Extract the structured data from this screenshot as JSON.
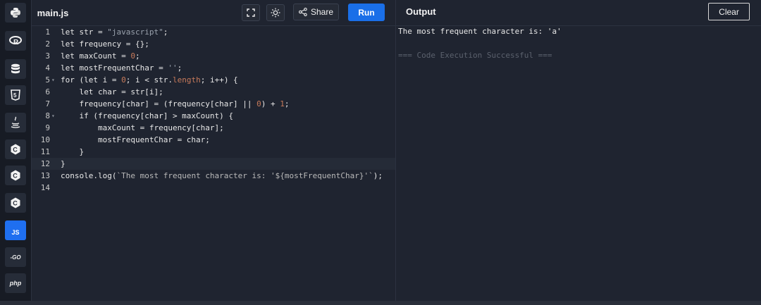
{
  "sidebar": {
    "items": [
      {
        "name": "python-icon",
        "label": ""
      },
      {
        "name": "r-icon",
        "label": "R"
      },
      {
        "name": "database-icon",
        "label": ""
      },
      {
        "name": "html5-icon",
        "label": "5"
      },
      {
        "name": "java-icon",
        "label": ""
      },
      {
        "name": "c-icon",
        "label": "C"
      },
      {
        "name": "cpp-icon",
        "label": "C"
      },
      {
        "name": "csharp-icon",
        "label": "C"
      },
      {
        "name": "javascript-icon",
        "label": "JS",
        "active": true
      },
      {
        "name": "go-icon",
        "label": "-GO"
      },
      {
        "name": "php-icon",
        "label": "php"
      }
    ]
  },
  "editor": {
    "file_name": "main.js",
    "share_label": "Share",
    "run_label": "Run",
    "lines": [
      {
        "n": "1",
        "fold": "",
        "html": "let str = <span class=\"str\">\"javascript\"</span>;"
      },
      {
        "n": "2",
        "fold": "",
        "html": "let frequency = {};"
      },
      {
        "n": "3",
        "fold": "",
        "html": "let maxCount = <span class=\"num\">0</span>;"
      },
      {
        "n": "4",
        "fold": "",
        "html": "let mostFrequentChar = <span class=\"str\">''</span>;"
      },
      {
        "n": "5",
        "fold": "▾",
        "html": "for (let i = <span class=\"num\">0</span>; i &lt; str.<span class=\"prop\">length</span>; i++) {"
      },
      {
        "n": "6",
        "fold": "",
        "html": "    let char = str[i];"
      },
      {
        "n": "7",
        "fold": "",
        "html": "    frequency[char] = (frequency[char] || <span class=\"num\">0</span>) + <span class=\"num\">1</span>;"
      },
      {
        "n": "8",
        "fold": "▾",
        "html": "    if (frequency[char] &gt; maxCount) {"
      },
      {
        "n": "9",
        "fold": "",
        "html": "        maxCount = frequency[char];"
      },
      {
        "n": "10",
        "fold": "",
        "html": "        mostFrequentChar = char;"
      },
      {
        "n": "11",
        "fold": "",
        "html": "    }"
      },
      {
        "n": "12",
        "fold": "",
        "html": "}",
        "current": true
      },
      {
        "n": "13",
        "fold": "",
        "html": "console.log(<span class=\"tpl\">`The most frequent character is: '${mostFrequentChar}'`</span>);"
      },
      {
        "n": "14",
        "fold": "",
        "html": ""
      }
    ]
  },
  "output": {
    "title": "Output",
    "clear_label": "Clear",
    "result_line": "The most frequent character is: 'a'",
    "status_line": "=== Code Execution Successful ==="
  }
}
